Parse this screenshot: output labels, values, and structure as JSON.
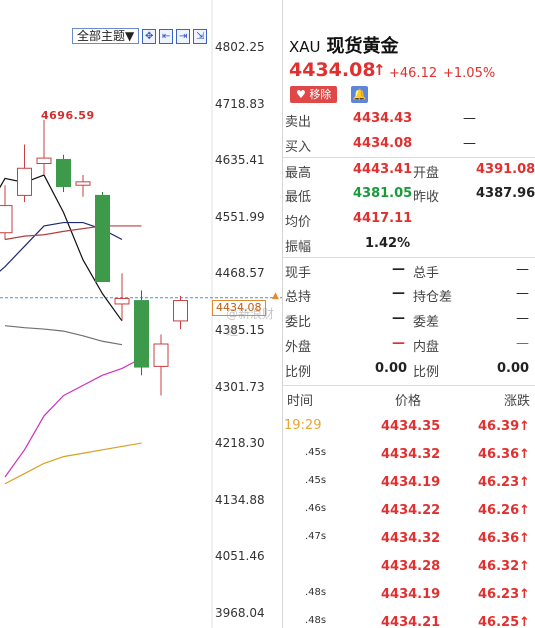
{
  "toolbar": {
    "theme_label": "全部主题▼",
    "icons": [
      "crosshair-icon",
      "zoom-in-icon",
      "zoom-out-icon",
      "fit-icon"
    ]
  },
  "chart": {
    "y_ticks": [
      "4802.25",
      "4718.83",
      "4635.41",
      "4551.99",
      "4468.57",
      "4385.15",
      "4301.73",
      "4218.30",
      "4134.88",
      "4051.46",
      "3968.04"
    ],
    "peak_label": "4696.59",
    "price_tag": "4434.08",
    "watermark": "@新浪财经"
  },
  "quote": {
    "symbol": "XAU",
    "name": "现货黄金",
    "price": "4434.08",
    "change": "+46.12",
    "change_pct": "+1.05%",
    "remove_label": "移除",
    "rows": [
      {
        "l1": "卖出",
        "v1": "4434.43",
        "c1": "red",
        "l2": "",
        "v2": "—",
        "c2": "dark"
      },
      {
        "l1": "买入",
        "v1": "4434.08",
        "c1": "red",
        "l2": "",
        "v2": "—",
        "c2": "dark"
      },
      {
        "l1": "最高",
        "v1": "4443.41",
        "c1": "red",
        "l2": "开盘",
        "v2": "4391.08",
        "c2": "red"
      },
      {
        "l1": "最低",
        "v1": "4381.05",
        "c1": "green",
        "l2": "昨收",
        "v2": "4387.96",
        "c2": "dark"
      },
      {
        "l1": "均价",
        "v1": "4417.11",
        "c1": "red",
        "l2": "",
        "v2": "",
        "c2": "dark"
      },
      {
        "l1": "振幅",
        "v1": "1.42%",
        "c1": "dark",
        "l2": "",
        "v2": "",
        "c2": "dark"
      },
      {
        "l1": "现手",
        "v1": "—",
        "c1": "dark",
        "l2": "总手",
        "v2": "—",
        "c2": "dark"
      },
      {
        "l1": "总持",
        "v1": "—",
        "c1": "dark",
        "l2": "持仓差",
        "v2": "—",
        "c2": "dark"
      },
      {
        "l1": "委比",
        "v1": "—",
        "c1": "dark",
        "l2": "委差",
        "v2": "—",
        "c2": "dark"
      },
      {
        "l1": "外盘",
        "v1": "—",
        "c1": "red",
        "l2": "内盘",
        "v2": "—",
        "c2": "green"
      },
      {
        "l1": "比例",
        "v1": "0.00",
        "c1": "dark",
        "l2": "比例",
        "v2": "0.00",
        "c2": "dark"
      }
    ],
    "trade_header": {
      "time": "时间",
      "price": "价格",
      "change": "涨跌"
    },
    "trades": [
      {
        "time": "19:29",
        "price": "4434.35",
        "change": "46.39"
      },
      {
        "time": ".45s",
        "price": "4434.32",
        "change": "46.36"
      },
      {
        "time": ".45s",
        "price": "4434.19",
        "change": "46.23"
      },
      {
        "time": ".46s",
        "price": "4434.22",
        "change": "46.26"
      },
      {
        "time": ".47s",
        "price": "4434.32",
        "change": "46.36"
      },
      {
        "time": "",
        "price": "4434.28",
        "change": "46.32"
      },
      {
        "time": ".48s",
        "price": "4434.19",
        "change": "46.23"
      },
      {
        "time": ".48s",
        "price": "4434.21",
        "change": "46.25"
      }
    ]
  },
  "colors": {
    "up": "#e03030",
    "down": "#1a9a3a",
    "candle_down": "#3c9a4a",
    "ma_black": "#111111",
    "ma_navy": "#1e2a6a",
    "ma_red": "#b04040",
    "ma_magenta": "#d030c0",
    "ma_orange": "#d9a020",
    "ma_gray": "#707070",
    "price_line": "#4a90d0"
  },
  "chart_data": {
    "type": "candlestick",
    "y_range": [
      3968.04,
      4802.25
    ],
    "candles": [
      {
        "o": 4530,
        "h": 4600,
        "l": 4520,
        "c": 4570,
        "dir": "up"
      },
      {
        "o": 4585,
        "h": 4660,
        "l": 4575,
        "c": 4625,
        "dir": "up"
      },
      {
        "o": 4632,
        "h": 4696.59,
        "l": 4615,
        "c": 4640,
        "dir": "up"
      },
      {
        "o": 4638,
        "h": 4645,
        "l": 4590,
        "c": 4598,
        "dir": "down"
      },
      {
        "o": 4600,
        "h": 4615,
        "l": 4583,
        "c": 4605,
        "dir": "up"
      },
      {
        "o": 4585,
        "h": 4590,
        "l": 4480,
        "c": 4458,
        "dir": "down"
      },
      {
        "o": 4425,
        "h": 4470,
        "l": 4400,
        "c": 4433,
        "dir": "up"
      },
      {
        "o": 4430,
        "h": 4445,
        "l": 4320,
        "c": 4332,
        "dir": "down"
      },
      {
        "o": 4333,
        "h": 4380,
        "l": 4290,
        "c": 4366,
        "dir": "up"
      },
      {
        "o": 4400,
        "h": 4437,
        "l": 4388,
        "c": 4430,
        "dir": "up"
      }
    ],
    "ma_lines": [
      {
        "color": "ma_black",
        "y": [
          4505,
          4560,
          4610,
          4604,
          4615,
          4560,
          4490,
          4440,
          4400
        ]
      },
      {
        "color": "ma_navy",
        "y": [
          4430,
          4455,
          4480,
          4510,
          4540,
          4545,
          4545,
          4535,
          4520
        ]
      },
      {
        "color": "ma_red",
        "y": [
          4520,
          4525,
          4527,
          4532,
          4536,
          4540,
          4540,
          4540
        ]
      },
      {
        "color": "ma_gray",
        "y": [
          4393,
          4390,
          4388,
          4385,
          4378,
          4370,
          4365
        ]
      },
      {
        "color": "ma_magenta",
        "y": [
          4170,
          4210,
          4260,
          4290,
          4305,
          4320,
          4330,
          4345
        ]
      },
      {
        "color": "ma_orange",
        "y": [
          4160,
          4175,
          4190,
          4200,
          4205,
          4210,
          4215,
          4220
        ]
      }
    ],
    "current_price": 4434.08
  }
}
